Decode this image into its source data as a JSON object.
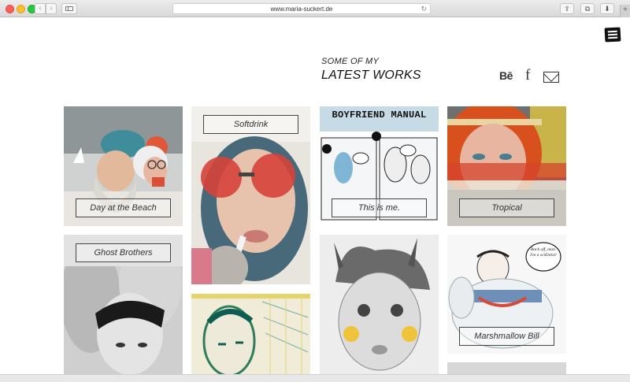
{
  "browser": {
    "url": "www.maria-suckert.de",
    "back_glyph": "‹",
    "forward_glyph": "›",
    "reload_glyph": "↻",
    "share_glyph": "⇪",
    "tabs_glyph": "⧉",
    "download_glyph": "⬇",
    "newtab_glyph": "+"
  },
  "header": {
    "kicker": "SOME OF MY",
    "title": "LATEST WORKS"
  },
  "social": {
    "behance": "Bē",
    "facebook": "f"
  },
  "gallery": {
    "labels": {
      "day_at_the_beach": "Day at the Beach",
      "softdrink": "Softdrink",
      "this_is_me": "This is me.",
      "tropical": "Tropical",
      "ghost_brothers": "Ghost Brothers",
      "marshmallow_bill": "Marshmallow Bill"
    },
    "artwork_text": {
      "boyfriend_manual_title": "BOYFRIEND MANUAL",
      "speech_bubble": "Back off, man. I'm a sciEntist!"
    }
  },
  "colors": {
    "accent_dark": "#111111",
    "traffic_red": "#fc5f57",
    "traffic_yellow": "#fdbc2e",
    "traffic_green": "#28c840"
  }
}
